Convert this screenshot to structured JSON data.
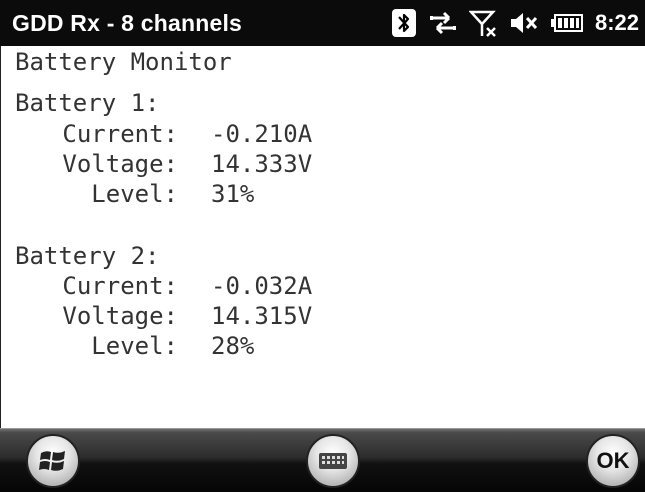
{
  "titlebar": {
    "app_title": "GDD Rx - 8 channels",
    "clock": "8:22",
    "icons": [
      "bluetooth-icon",
      "connectivity-arrows-icon",
      "no-signal-icon",
      "speaker-muted-icon",
      "battery-icon"
    ]
  },
  "content": {
    "heading": "Battery Monitor",
    "batteries": [
      {
        "name": "Battery 1:",
        "current_label": "Current:",
        "current": "-0.210A",
        "voltage_label": "Voltage:",
        "voltage": "14.333V",
        "level_label": "Level:",
        "level": "31%"
      },
      {
        "name": "Battery 2:",
        "current_label": "Current:",
        "current": "-0.032A",
        "voltage_label": "Voltage:",
        "voltage": "14.315V",
        "level_label": "Level:",
        "level": "28%"
      }
    ]
  },
  "bottombar": {
    "start_icon": "windows-flag-icon",
    "keyboard_icon": "keyboard-icon",
    "ok_label": "OK"
  }
}
